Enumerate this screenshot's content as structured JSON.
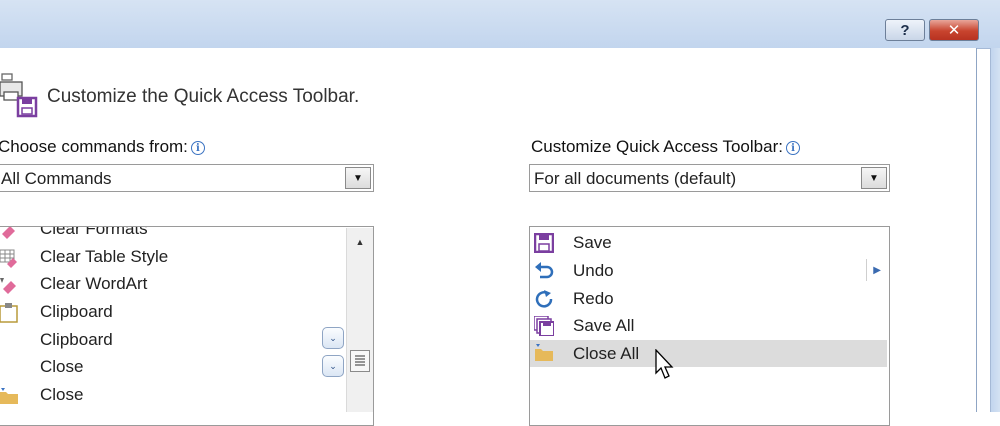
{
  "dialog": {
    "help_label": "?",
    "close_label": "✕"
  },
  "header": {
    "title": "Customize the Quick Access Toolbar."
  },
  "left": {
    "choose_label": "Choose commands from:",
    "choose_value": "All Commands",
    "commands": [
      {
        "label": "Clear Formats",
        "icon": "eraser-icon"
      },
      {
        "label": "Clear Table Style",
        "icon": "table-eraser-icon"
      },
      {
        "label": "Clear WordArt",
        "icon": "eraser-icon"
      },
      {
        "label": "Clipboard",
        "icon": "clipboard-icon"
      },
      {
        "label": "Clipboard",
        "icon": ""
      },
      {
        "label": "Close",
        "icon": ""
      },
      {
        "label": "Close",
        "icon": "folder-icon"
      }
    ]
  },
  "right": {
    "customize_label": "Customize Quick Access Toolbar:",
    "customize_value": "For all documents (default)",
    "toolbar_items": [
      {
        "label": "Save",
        "icon": "save-icon"
      },
      {
        "label": "Undo",
        "icon": "undo-icon"
      },
      {
        "label": "Redo",
        "icon": "redo-icon"
      },
      {
        "label": "Save All",
        "icon": "save-all-icon"
      },
      {
        "label": "Close All",
        "icon": "folder-icon"
      }
    ],
    "selected_index": 4
  },
  "colors": {
    "accent": "#7b3fa0",
    "selection": "#dcdcdc",
    "link_blue": "#3b73c2"
  }
}
